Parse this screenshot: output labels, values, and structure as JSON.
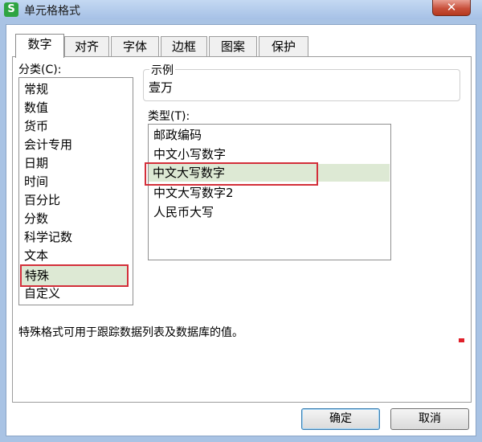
{
  "window": {
    "title": "单元格格式",
    "app_icon_glyph": "S",
    "close_glyph": "✕"
  },
  "tabs": [
    "数字",
    "对齐",
    "字体",
    "边框",
    "图案",
    "保护"
  ],
  "category": {
    "label": "分类(C):",
    "items": [
      "常规",
      "数值",
      "货币",
      "会计专用",
      "日期",
      "时间",
      "百分比",
      "分数",
      "科学记数",
      "文本",
      "特殊",
      "自定义"
    ],
    "selected": "特殊"
  },
  "sample": {
    "legend": "示例",
    "value": "壹万"
  },
  "type": {
    "label": "类型(T):",
    "items": [
      "邮政编码",
      "中文小写数字",
      "中文大写数字",
      "中文大写数字2",
      "人民币大写"
    ],
    "selected": "中文大写数字"
  },
  "description": "特殊格式可用于跟踪数据列表及数据库的值。",
  "buttons": {
    "ok": "确定",
    "cancel": "取消"
  },
  "colors": {
    "highlight": "#dde9d4",
    "annotation_red": "#d32f3a",
    "title_bar": "#a6c1e6",
    "app_icon": "#2ea442"
  }
}
